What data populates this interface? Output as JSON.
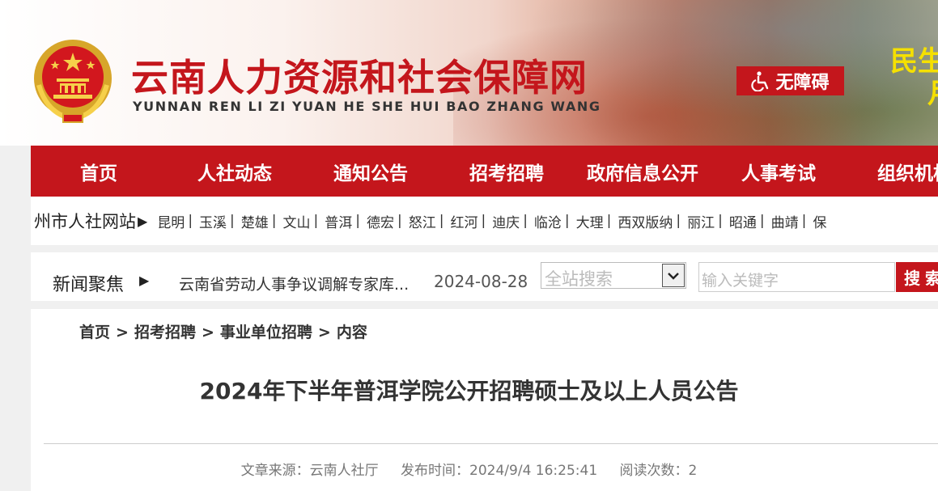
{
  "header": {
    "site_title": "云南人力资源和社会保障网",
    "site_pinyin": "YUNNAN REN LI ZI YUAN HE SHE HUI BAO ZHANG WANG",
    "accessibility_label": "无障碍",
    "slogan_line1": "民生",
    "slogan_line2": "月"
  },
  "nav": {
    "items": [
      "首页",
      "人社动态",
      "通知公告",
      "招考招聘",
      "政府信息公开",
      "人事考试",
      "组织机构"
    ]
  },
  "citybar": {
    "label": "州市人社网站",
    "cities": [
      "昆明",
      "玉溪",
      "楚雄",
      "文山",
      "普洱",
      "德宏",
      "怒江",
      "红河",
      "迪庆",
      "临沧",
      "大理",
      "西双版纳",
      "丽江",
      "昭通",
      "曲靖",
      "保"
    ]
  },
  "news": {
    "label": "新闻聚焦",
    "headline": "云南省劳动人事争议调解专家库...",
    "date": "2024-08-28"
  },
  "search": {
    "scope_value": "全站搜索",
    "placeholder": "输入关键字",
    "button_label": "搜索"
  },
  "breadcrumb": [
    "首页",
    "招考招聘",
    "事业单位招聘",
    "内容"
  ],
  "article": {
    "title": "2024年下半年普洱学院公开招聘硕士及以上人员公告",
    "source_label": "文章来源：",
    "source": "云南人社厅",
    "published_label": "发布时间：",
    "published": "2024/9/4 16:25:41",
    "views_label": "阅读次数：",
    "views": "2"
  },
  "colors": {
    "brand_red": "#c4161c",
    "slogan_yellow": "#f5e000"
  }
}
